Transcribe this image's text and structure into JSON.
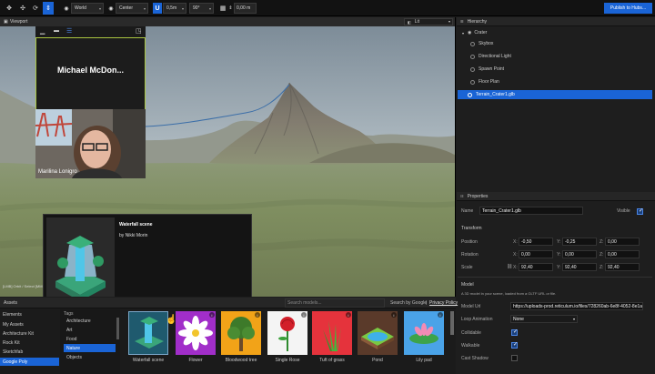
{
  "toolbar": {
    "space_select": "World",
    "pivot_select": "Center",
    "snap_select": "0,5m",
    "angle_select": "90°",
    "grid_value": "0,00",
    "grid_unit": "m",
    "publish_label": "Publish to Hubs..."
  },
  "viewport": {
    "title": "Viewport",
    "render_mode": "Lit",
    "status_text": "[LMB] Orbit / Select  [MMB] Pan  [RMB] Fly"
  },
  "video_call": {
    "participant_name_tile": "Michael  McDon...",
    "participant_label": "Marilina Lonigro"
  },
  "asset_preview": {
    "title": "Waterfall scene",
    "author": "by Nikki Morin"
  },
  "hierarchy": {
    "title": "Hierarchy",
    "root": "Crater",
    "items": [
      "Skybox",
      "Directional Light",
      "Spawn Point",
      "Floor Plan",
      "Terrain_Crater1.glb"
    ]
  },
  "properties": {
    "title": "Properties",
    "name_label": "Name",
    "name_value": "Terrain_Crater1.glb",
    "visible_label": "Visible",
    "visible": true,
    "transform_label": "Transform",
    "position_label": "Position",
    "position": {
      "x": "-0,50",
      "y": "-0,25",
      "z": "0,00"
    },
    "rotation_label": "Rotation",
    "rotation": {
      "x": "0,00",
      "y": "0,00",
      "z": "0,00"
    },
    "scale_label": "Scale",
    "scale": {
      "x": "92,40",
      "y": "92,40",
      "z": "92,40"
    },
    "model_label": "Model",
    "model_desc": "A 3D model in your scene, loaded from a GLTF URL or file.",
    "model_url_label": "Model Url",
    "model_url": "https://uploads-prod.reticulum.io/files/728260ab-6e8f-4052-8e1a",
    "loop_animation_label": "Loop Animation",
    "loop_animation_value": "None",
    "collidable_label": "Collidable",
    "collidable": true,
    "walkable_label": "Walkable",
    "walkable": true,
    "cast_shadow_label": "Cast Shadow",
    "cast_shadow": false
  },
  "assets": {
    "title": "Assets",
    "search_placeholder": "Search models...",
    "search_by": "Search by Google",
    "privacy_policy": "Privacy Policy",
    "categories": [
      "Elements",
      "My Assets",
      "Architecture Kit",
      "Rock Kit",
      "Sketchfab",
      "Google Poly"
    ],
    "selected_category": "Google Poly",
    "tags_label": "Tags",
    "tags": [
      "Architecture",
      "Art",
      "Food",
      "Nature",
      "Objects"
    ],
    "selected_tag": "Nature",
    "items": [
      "Waterfall scene",
      "Flower",
      "Bloodwood tree",
      "Single Rose",
      "Tuft of grass",
      "Pond",
      "Lily pad"
    ]
  },
  "colors": {
    "accent": "#1a64d6",
    "panel_bg": "#1e1e1e",
    "sky": "#9aa9b4",
    "ground": "#7f8c66"
  }
}
